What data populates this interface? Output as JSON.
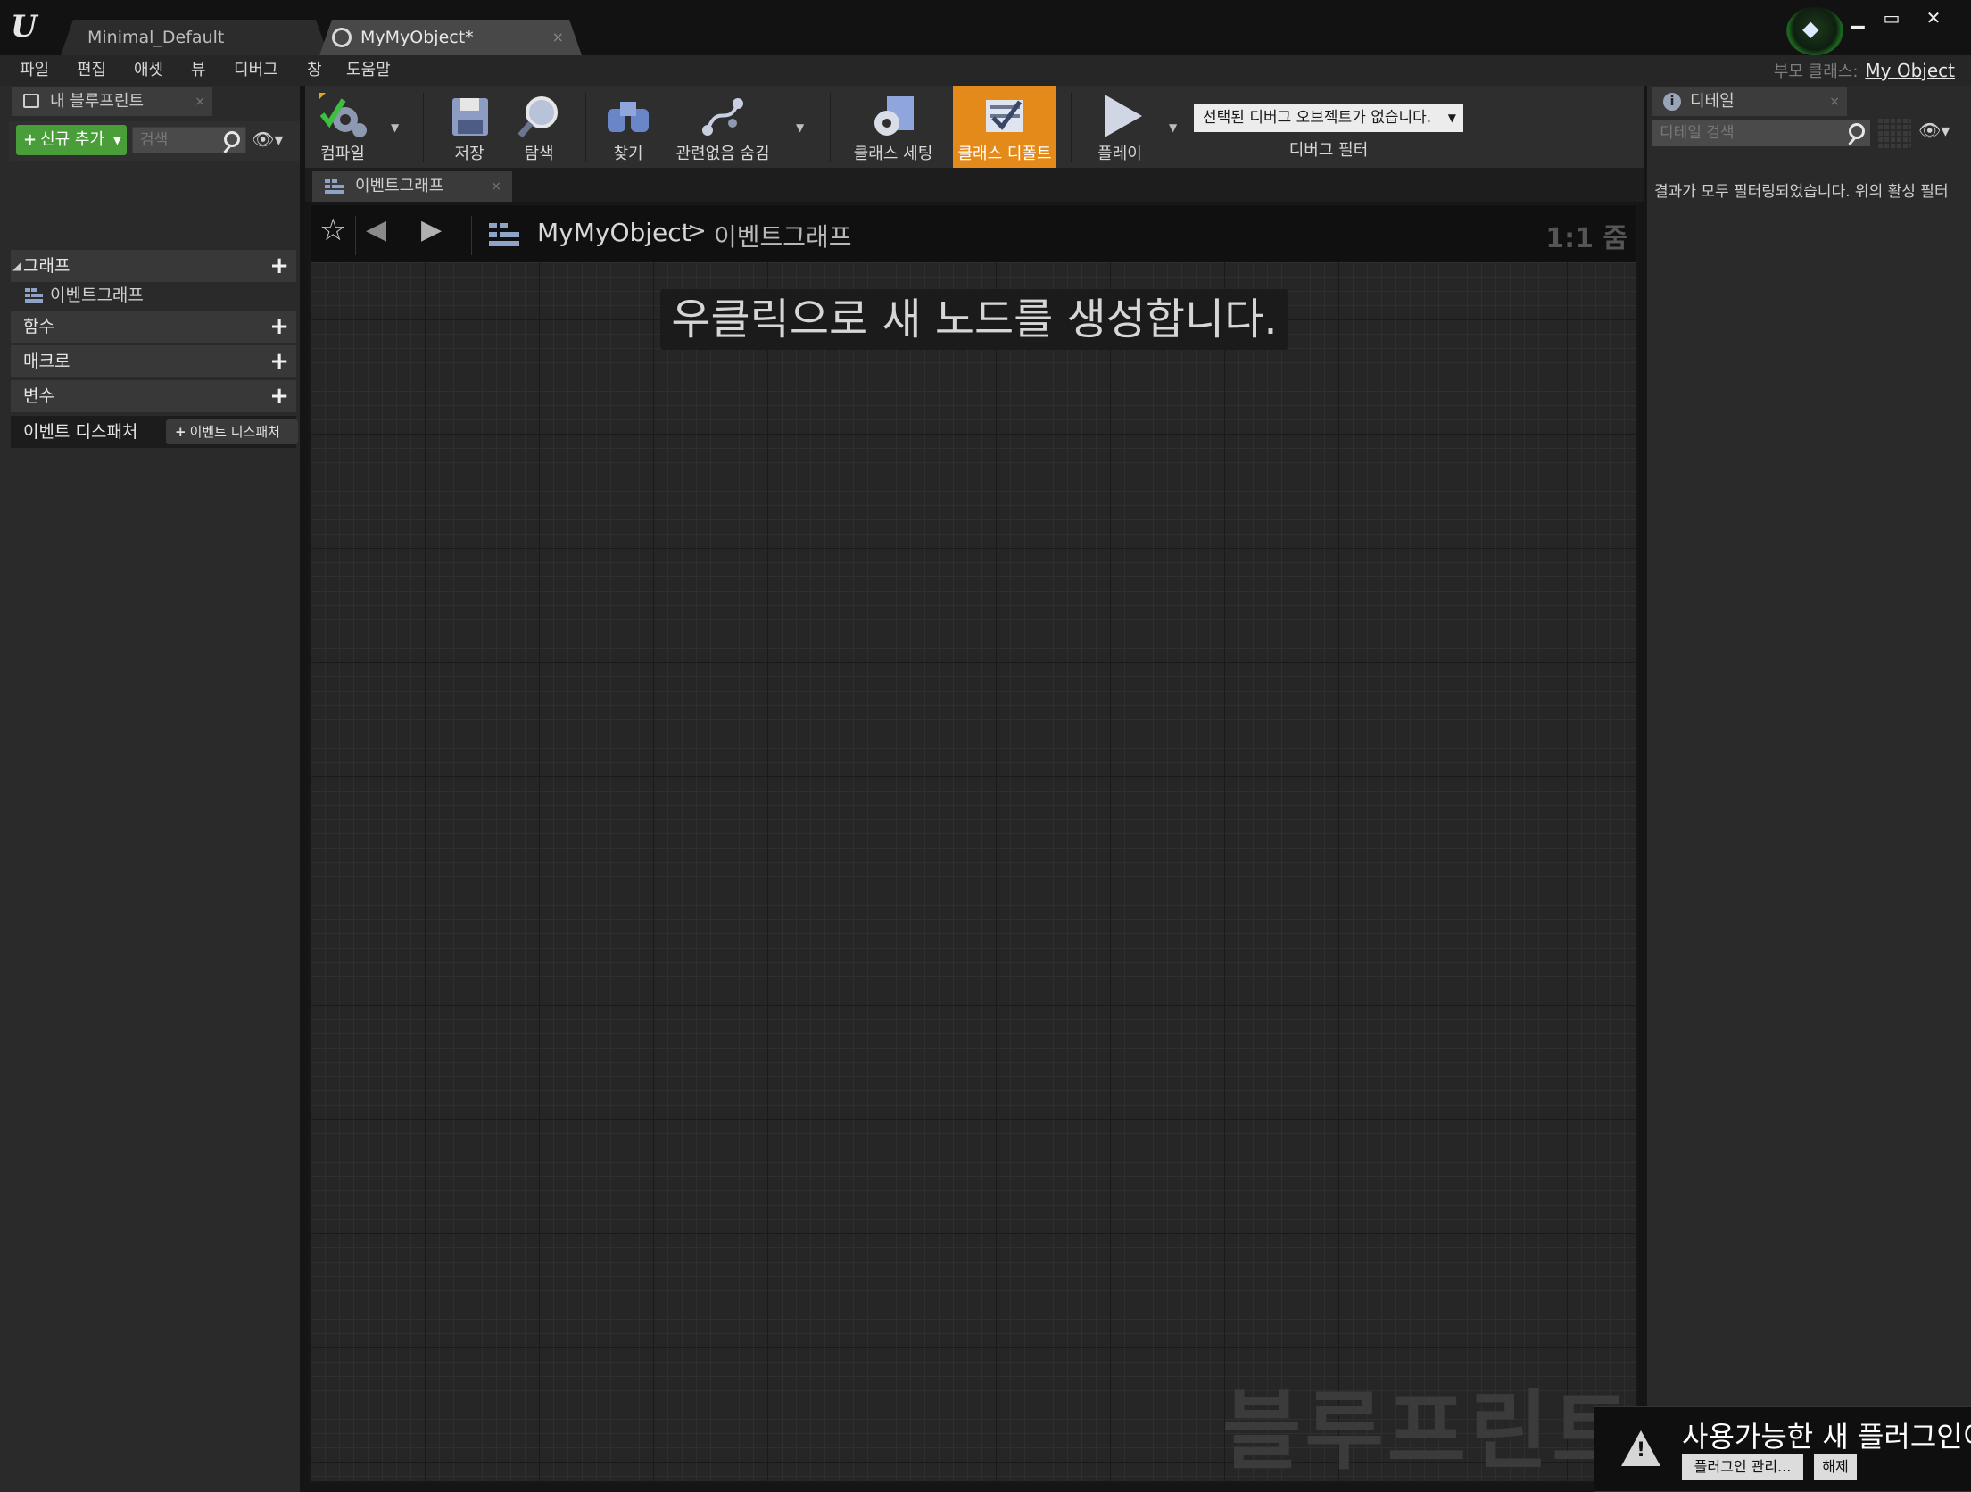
{
  "window": {
    "tabs": [
      {
        "label": "Minimal_Default",
        "active": false
      },
      {
        "label": "MyMyObject*",
        "active": true
      }
    ],
    "controls": {
      "minimize": "▁",
      "maximize": "▭",
      "close": "✕"
    }
  },
  "menu": {
    "items": [
      "파일",
      "편집",
      "애셋",
      "뷰",
      "디버그",
      "창",
      "도움말"
    ],
    "parent_class_label": "부모 클래스:",
    "parent_class_value": "My Object"
  },
  "left_panel": {
    "tab_label": "내 블루프린트",
    "add_new_label": "신규 추가",
    "search_placeholder": "검색",
    "sections": {
      "graph": "그래프",
      "graph_item": "이벤트그래프",
      "functions": "함수",
      "macros": "매크로",
      "variables": "변수",
      "event_dispatchers": "이벤트 디스패처",
      "add_dispatcher": "이벤트 디스패처"
    },
    "plus": "+"
  },
  "toolbar": {
    "compile": "컴파일",
    "save": "저장",
    "browse": "탐색",
    "find": "찾기",
    "hide_unrelated": "관련없음 숨김",
    "class_settings": "클래스 세팅",
    "class_defaults": "클래스 디폴트",
    "play": "플레이",
    "debug_object": "선택된 디버그 오브젝트가 없습니다.",
    "debug_filter": "디버그 필터"
  },
  "graph": {
    "tab_label": "이벤트그래프",
    "breadcrumb_root": "MyMyObject",
    "breadcrumb_current": "이벤트그래프",
    "zoom": "1:1 줌",
    "hint": "우클릭으로 새 노드를 생성합니다.",
    "watermark": "블루프린트"
  },
  "details": {
    "tab_label": "디테일",
    "search_placeholder": "디테일 검색",
    "message": "결과가 모두 필터링되었습니다. 위의 활성 필터"
  },
  "notification": {
    "text": "사용가능한 새 플러그인이",
    "manage_button": "플러그인 관리...",
    "dismiss_button": "해제"
  },
  "colors": {
    "accent_orange": "#e48a1a",
    "add_green": "#4a9e3a",
    "background": "#262626"
  }
}
